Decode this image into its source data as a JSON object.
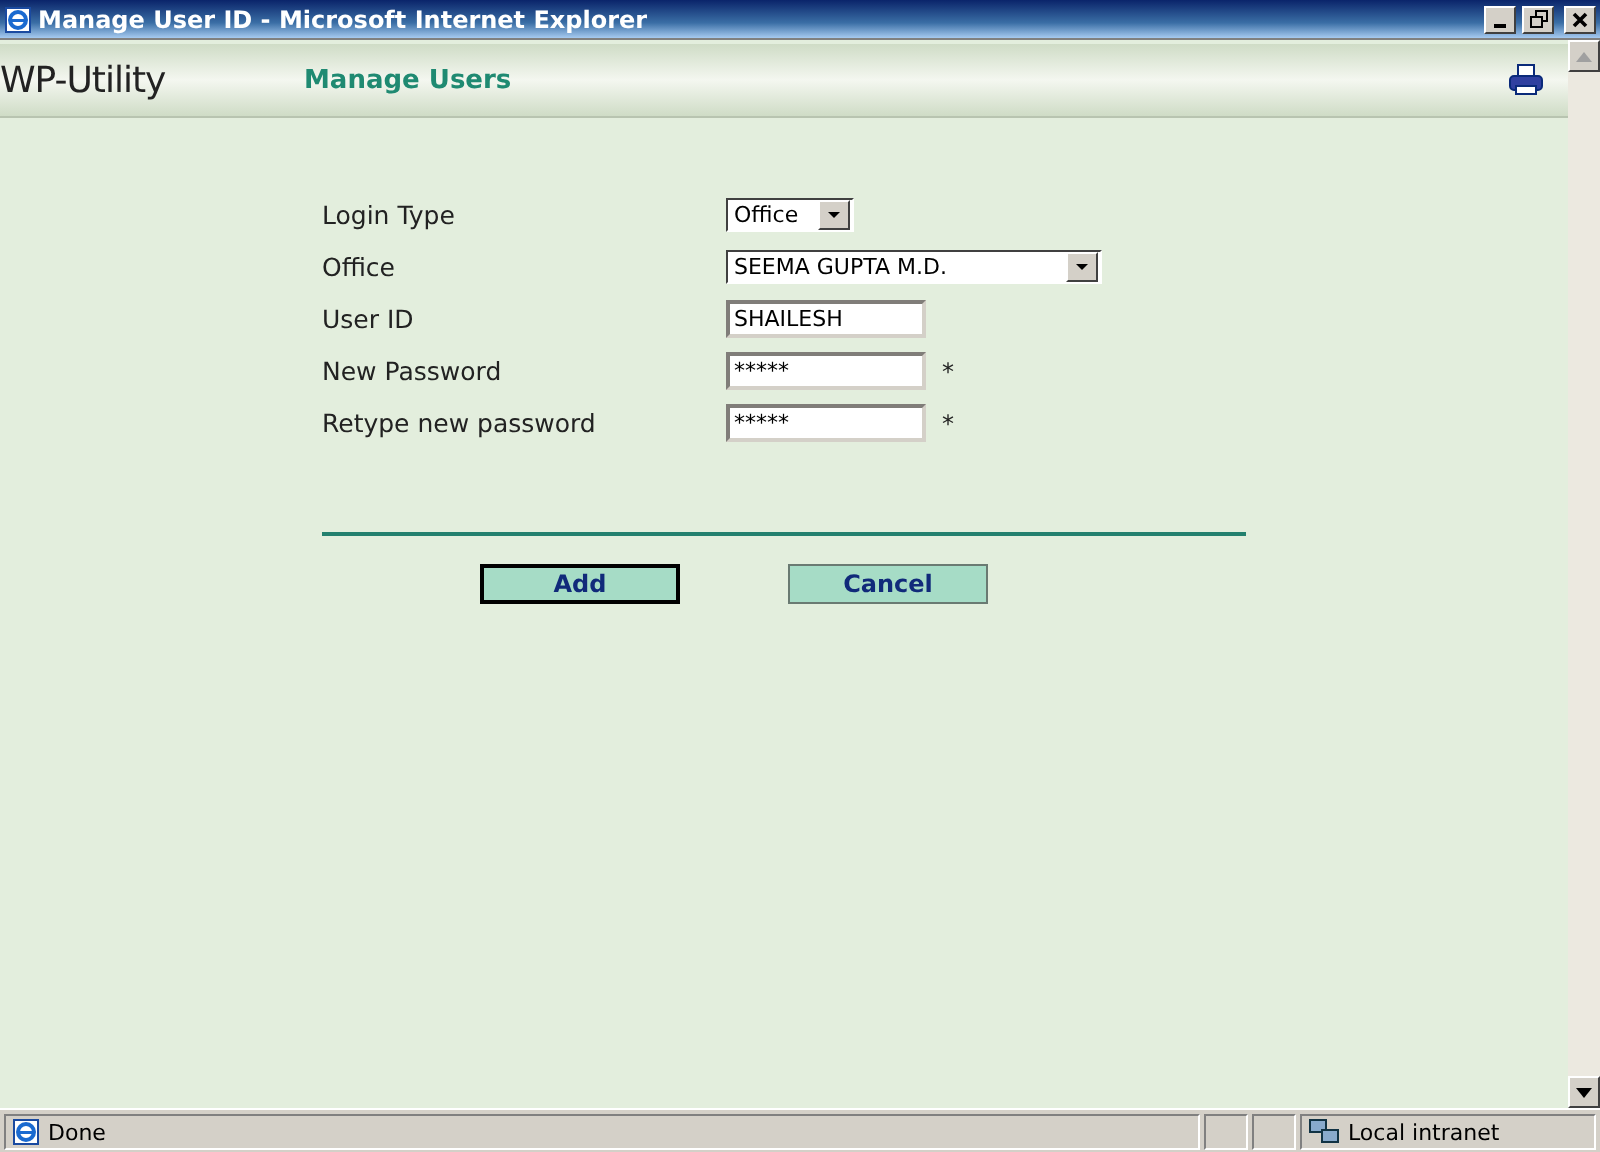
{
  "window": {
    "title": "Manage User ID - Microsoft Internet Explorer"
  },
  "header": {
    "app_name": "WP-Utility",
    "page_title": "Manage Users"
  },
  "form": {
    "fields": [
      {
        "label": "Login Type",
        "kind": "select",
        "value": "Office"
      },
      {
        "label": "Office",
        "kind": "select",
        "value": "SEEMA GUPTA M.D."
      },
      {
        "label": "User ID",
        "kind": "text",
        "value": "SHAILESH"
      },
      {
        "label": "New Password",
        "kind": "text",
        "value": "*****",
        "mark": "*"
      },
      {
        "label": "Retype new password",
        "kind": "text",
        "value": "*****",
        "mark": "*"
      }
    ]
  },
  "buttons": [
    {
      "label": "Add",
      "default": true
    },
    {
      "label": "Cancel",
      "default": false
    }
  ],
  "status_bar": {
    "text": "Done",
    "zone": "Local intranet"
  }
}
